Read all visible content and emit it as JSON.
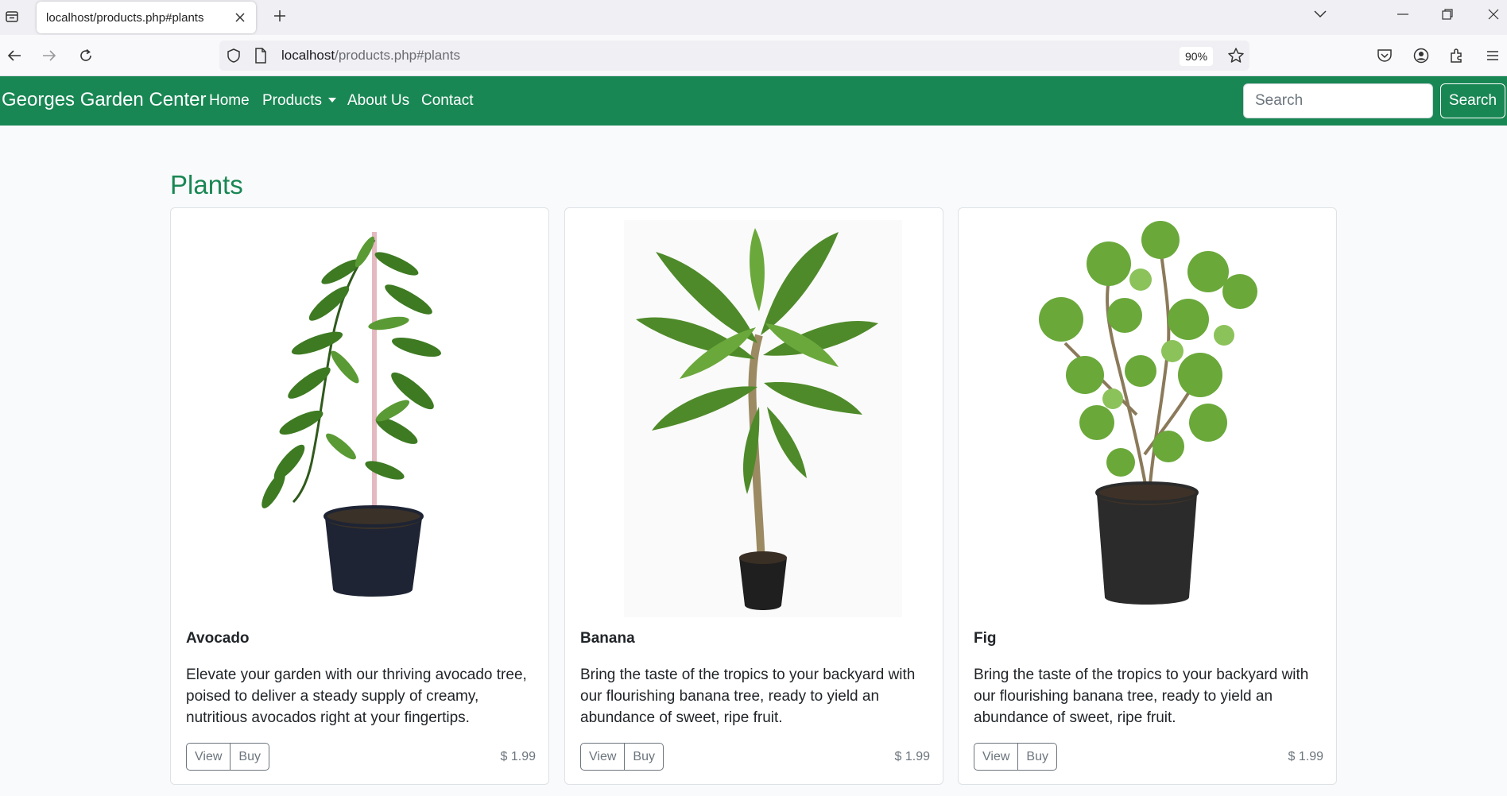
{
  "browser": {
    "tab_title": "localhost/products.php#plants",
    "url_host": "localhost",
    "url_path": "/products.php#plants",
    "zoom": "90%"
  },
  "site": {
    "brand": "Georges Garden Center",
    "nav": {
      "home": "Home",
      "products": "Products",
      "about": "About Us",
      "contact": "Contact"
    },
    "search_placeholder": "Search",
    "search_button": "Search",
    "accent_color": "#198754"
  },
  "section": {
    "title": "Plants"
  },
  "cards": [
    {
      "title": "Avocado",
      "text": "Elevate your garden with our thriving avocado tree, poised to deliver a steady supply of creamy, nutritious avocados right at your fingertips.",
      "view_label": "View",
      "buy_label": "Buy",
      "price": "$ 1.99"
    },
    {
      "title": "Banana",
      "text": "Bring the taste of the tropics to your backyard with our flourishing banana tree, ready to yield an abundance of sweet, ripe fruit.",
      "view_label": "View",
      "buy_label": "Buy",
      "price": "$ 1.99"
    },
    {
      "title": "Fig",
      "text": "Bring the taste of the tropics to your backyard with our flourishing banana tree, ready to yield an abundance of sweet, ripe fruit.",
      "view_label": "View",
      "buy_label": "Buy",
      "price": "$ 1.99"
    }
  ]
}
